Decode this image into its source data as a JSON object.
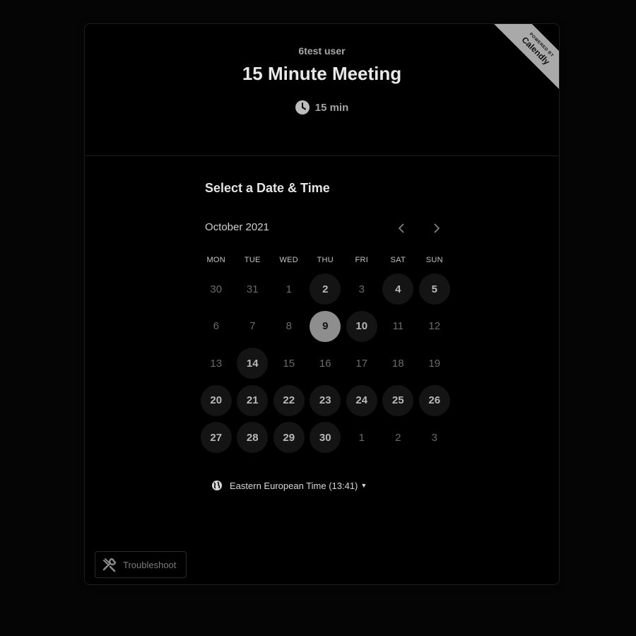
{
  "ribbon": {
    "powered_by": "POWERED BY",
    "brand": "Calendly"
  },
  "header": {
    "owner": "6test user",
    "title": "15 Minute Meeting",
    "duration": "15 min"
  },
  "scheduler": {
    "heading": "Select a Date & Time",
    "month": "October 2021",
    "weekdays": [
      "MON",
      "TUE",
      "WED",
      "THU",
      "FRI",
      "SAT",
      "SUN"
    ],
    "days": [
      {
        "label": "30",
        "state": "disabled"
      },
      {
        "label": "31",
        "state": "disabled"
      },
      {
        "label": "1",
        "state": "disabled"
      },
      {
        "label": "2",
        "state": "available"
      },
      {
        "label": "3",
        "state": "disabled"
      },
      {
        "label": "4",
        "state": "available"
      },
      {
        "label": "5",
        "state": "available"
      },
      {
        "label": "6",
        "state": "disabled"
      },
      {
        "label": "7",
        "state": "disabled"
      },
      {
        "label": "8",
        "state": "disabled"
      },
      {
        "label": "9",
        "state": "selected"
      },
      {
        "label": "10",
        "state": "available"
      },
      {
        "label": "11",
        "state": "disabled"
      },
      {
        "label": "12",
        "state": "disabled"
      },
      {
        "label": "13",
        "state": "disabled"
      },
      {
        "label": "14",
        "state": "available"
      },
      {
        "label": "15",
        "state": "disabled"
      },
      {
        "label": "16",
        "state": "disabled"
      },
      {
        "label": "17",
        "state": "disabled"
      },
      {
        "label": "18",
        "state": "disabled"
      },
      {
        "label": "19",
        "state": "disabled"
      },
      {
        "label": "20",
        "state": "available"
      },
      {
        "label": "21",
        "state": "available"
      },
      {
        "label": "22",
        "state": "available"
      },
      {
        "label": "23",
        "state": "available"
      },
      {
        "label": "24",
        "state": "available"
      },
      {
        "label": "25",
        "state": "available"
      },
      {
        "label": "26",
        "state": "available"
      },
      {
        "label": "27",
        "state": "available"
      },
      {
        "label": "28",
        "state": "available"
      },
      {
        "label": "29",
        "state": "available"
      },
      {
        "label": "30",
        "state": "available"
      },
      {
        "label": "1",
        "state": "disabled"
      },
      {
        "label": "2",
        "state": "disabled"
      },
      {
        "label": "3",
        "state": "disabled"
      }
    ],
    "timezone": "Eastern European Time (13:41)"
  },
  "footer": {
    "troubleshoot_label": "Troubleshoot"
  },
  "icons": {
    "clock": "clock-icon",
    "prev": "chevron-left-icon",
    "next": "chevron-right-icon",
    "globe": "globe-icon",
    "caret": "caret-down-icon",
    "wrench": "wrench-icon"
  },
  "colors": {
    "background": "#050505",
    "card": "#000000",
    "selected_day": "#8e8e8e",
    "available_day": "#141414",
    "ribbon": "#a9a9a9"
  }
}
